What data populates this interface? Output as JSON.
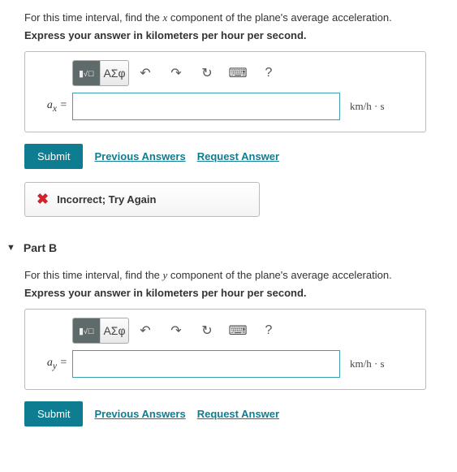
{
  "partA": {
    "prompt_pre": "For this time interval, find the ",
    "prompt_var": "x",
    "prompt_post": " component of the plane's average acceleration.",
    "instruction": "Express your answer in kilometers per hour per second.",
    "var_label": "a",
    "var_sub": "x",
    "equals": " = ",
    "value": "",
    "unit": "km/h · s",
    "submit": "Submit",
    "prev": "Previous Answers",
    "request": "Request Answer",
    "feedback": "Incorrect; Try Again"
  },
  "partB": {
    "header": "Part B",
    "prompt_pre": "For this time interval, find the ",
    "prompt_var": "y",
    "prompt_post": " component of the plane's average acceleration.",
    "instruction": "Express your answer in kilometers per hour per second.",
    "var_label": "a",
    "var_sub": "y",
    "equals": " = ",
    "value": "",
    "unit": "km/h · s",
    "submit": "Submit",
    "prev": "Previous Answers",
    "request": "Request Answer"
  },
  "toolbar": {
    "template": "▮√☐",
    "greek": "ΑΣφ",
    "undo": "↶",
    "redo": "↷",
    "reset": "↻",
    "keyboard": "⌨",
    "help": "?"
  }
}
